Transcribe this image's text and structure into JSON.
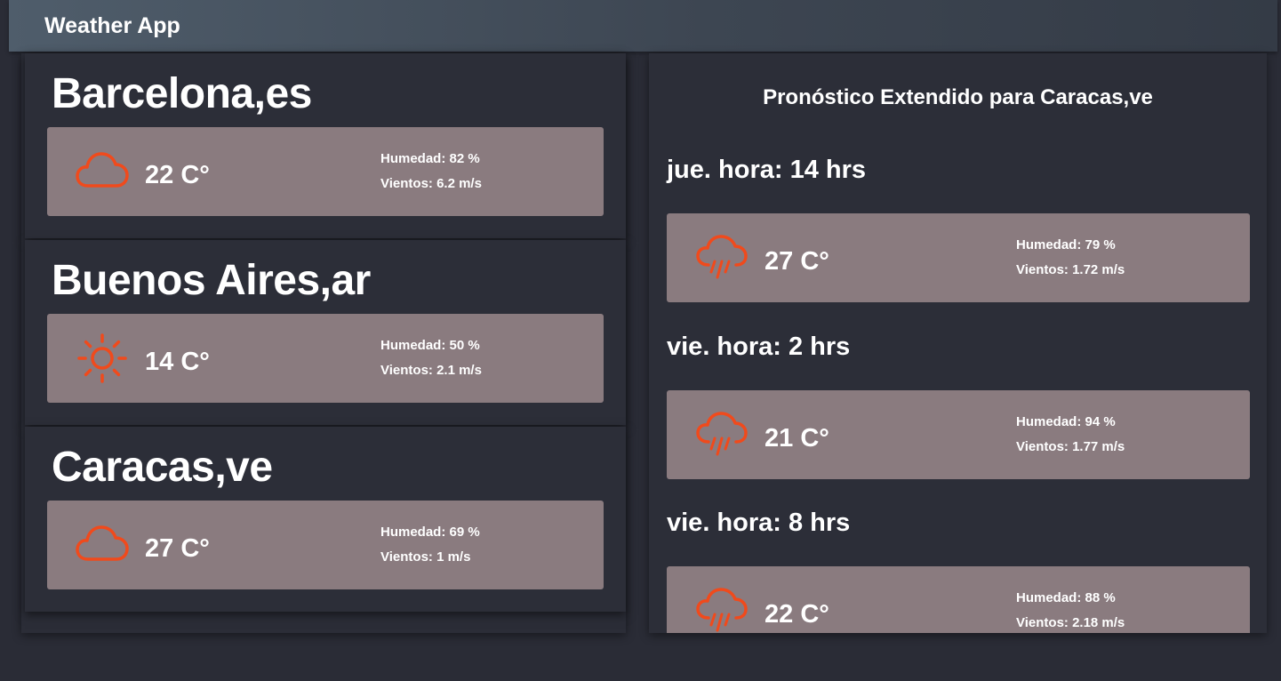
{
  "app": {
    "title": "Weather App"
  },
  "colors": {
    "icon": "#f04a1c",
    "card": "#8a7b7f",
    "background": "#2a2c36"
  },
  "cities": [
    {
      "name": "Barcelona,es",
      "icon": "cloud-icon",
      "temp": "22 C°",
      "humidity": "Humedad: 82 %",
      "wind": "Vientos: 6.2 m/s"
    },
    {
      "name": "Buenos Aires,ar",
      "icon": "sun-icon",
      "temp": "14 C°",
      "humidity": "Humedad: 50 %",
      "wind": "Vientos: 2.1 m/s"
    },
    {
      "name": "Caracas,ve",
      "icon": "cloud-icon",
      "temp": "27 C°",
      "humidity": "Humedad: 69 %",
      "wind": "Vientos: 1 m/s"
    }
  ],
  "forecast": {
    "title": "Pronóstico Extendido para Caracas,ve",
    "items": [
      {
        "label": "jue. hora: 14 hrs",
        "icon": "rain-icon",
        "temp": "27 C°",
        "humidity": "Humedad: 79 %",
        "wind": "Vientos: 1.72 m/s"
      },
      {
        "label": "vie. hora: 2 hrs",
        "icon": "rain-icon",
        "temp": "21 C°",
        "humidity": "Humedad: 94 %",
        "wind": "Vientos: 1.77 m/s"
      },
      {
        "label": "vie. hora: 8 hrs",
        "icon": "rain-icon",
        "temp": "22 C°",
        "humidity": "Humedad: 88 %",
        "wind": "Vientos: 2.18 m/s"
      }
    ]
  }
}
